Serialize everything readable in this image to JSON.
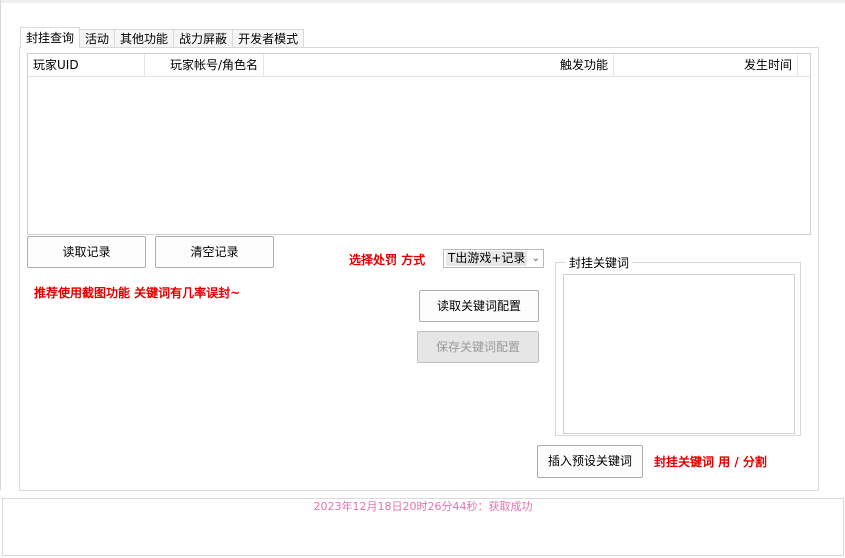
{
  "tabs": [
    "封挂查询",
    "活动",
    "其他功能",
    "战力屏蔽",
    "开发者模式"
  ],
  "active_tab": 0,
  "table": {
    "columns": [
      "玩家UID",
      "玩家帐号/角色名",
      "触发功能",
      "发生时间"
    ],
    "rows": []
  },
  "buttons": {
    "read_records": "读取记录",
    "clear_records": "清空记录",
    "read_keyword_config": "读取关键词配置",
    "save_keyword_config": "保存关键词配置",
    "insert_preset_keywords": "插入预设关键词"
  },
  "labels": {
    "punish_method": "选择处罚 方式",
    "recommend_tip": "推荐使用截图功能 关键词有几率误封~",
    "keyword_hint": "封挂关键词 用 / 分割"
  },
  "punish_select": {
    "value": "T出游戏+记录"
  },
  "keyword_group": {
    "title": "封挂关键词",
    "value": ""
  },
  "status": {
    "text": "2023年12月18日20时26分44秒：获取成功"
  },
  "colors": {
    "warning_red": "#e00000",
    "status_pink": "#e075b3"
  }
}
